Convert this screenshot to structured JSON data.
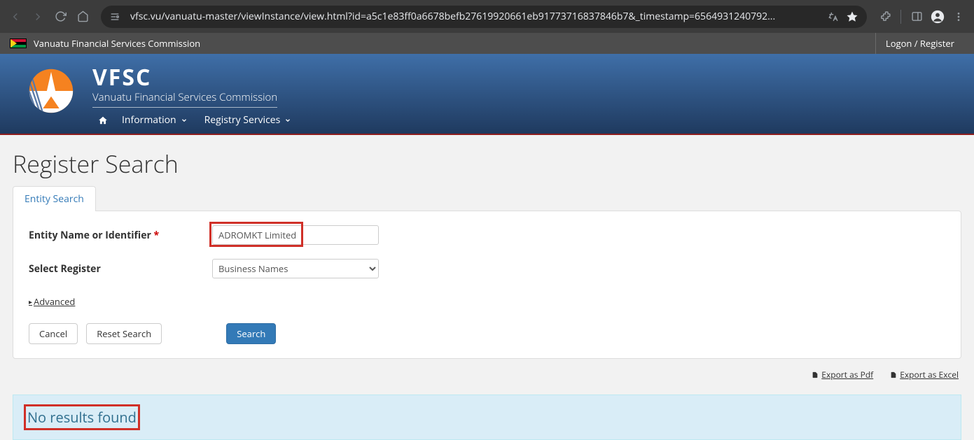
{
  "browser": {
    "url_display": "vfsc.vu/vanuatu-master/viewInstance/view.html?id=a5c1e83ff0a6678befb27619920661eb91773716837846b7&_timestamp=6564931240792..."
  },
  "topbar": {
    "org_name": "Vanuatu Financial Services Commission",
    "logon_label": "Logon / Register"
  },
  "brand": {
    "acronym": "VFSC",
    "full": "Vanuatu Financial Services Commission"
  },
  "nav": {
    "information": "Information",
    "registry": "Registry Services"
  },
  "page": {
    "title": "Register Search",
    "tab_label": "Entity Search"
  },
  "form": {
    "entity_label": "Entity Name or Identifier",
    "required_mark": "*",
    "entity_value": "ADROMKT Limited",
    "register_label": "Select Register",
    "register_value": "Business Names",
    "advanced_label": "Advanced",
    "cancel_label": "Cancel",
    "reset_label": "Reset Search",
    "search_label": "Search"
  },
  "export": {
    "pdf_label": "Export as Pdf",
    "excel_label": "Export as Excel"
  },
  "results": {
    "none_label": "No results found"
  }
}
